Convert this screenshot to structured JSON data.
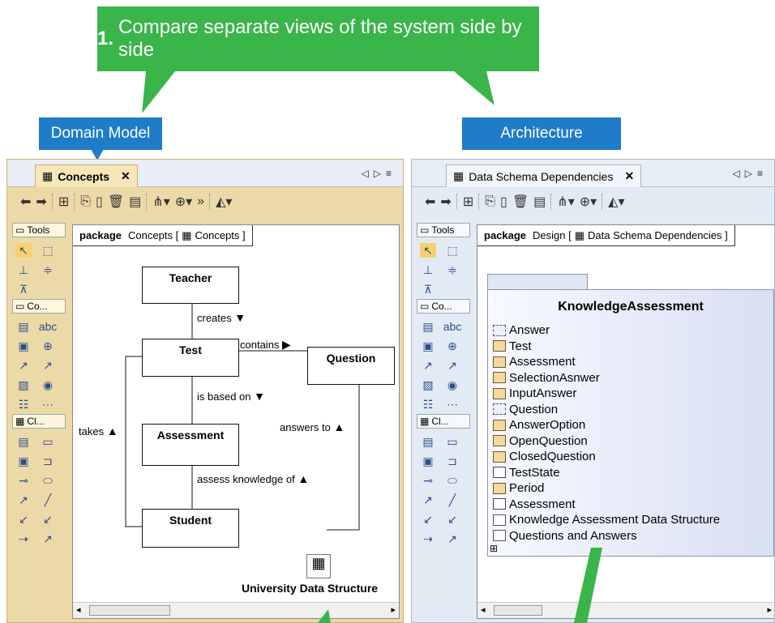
{
  "callouts": {
    "main_number": "1.",
    "main_text": "Compare separate views of the system side by side",
    "left": "Domain Model",
    "right": "Architecture"
  },
  "left": {
    "tab_label": "Concepts",
    "frame_keyword": "package",
    "frame_name": "Concepts [",
    "frame_diagram": "Concepts ]",
    "toolbox_tools": "Tools",
    "toolbox_co": "Co...",
    "toolbox_cl": "Cl...",
    "classes": {
      "teacher": "Teacher",
      "test": "Test",
      "question": "Question",
      "assessment": "Assessment",
      "student": "Student"
    },
    "labels": {
      "creates": "creates",
      "contains": "contains",
      "is_based_on": "is based on",
      "answers_to": "answers to",
      "takes": "takes",
      "assess_knowledge_of": "assess knowledge of"
    },
    "diagram_ref": "University Data Structure"
  },
  "right": {
    "tab_label": "Data Schema Dependencies",
    "frame_keyword": "package",
    "frame_name": "Design [",
    "frame_diagram": "Data Schema Dependencies ]",
    "toolbox_tools": "Tools",
    "toolbox_co": "Co...",
    "toolbox_cl": "Cl...",
    "package_title": "KnowledgeAssessment",
    "items": [
      {
        "label": "Answer",
        "icon": "dash"
      },
      {
        "label": "Test",
        "icon": "class"
      },
      {
        "label": "Assessment",
        "icon": "class"
      },
      {
        "label": "SelectionAsnwer",
        "icon": "class"
      },
      {
        "label": "InputAnswer",
        "icon": "class"
      },
      {
        "label": "Question",
        "icon": "dash"
      },
      {
        "label": "AnswerOption",
        "icon": "class"
      },
      {
        "label": "OpenQuestion",
        "icon": "class"
      },
      {
        "label": "ClosedQuestion",
        "icon": "class"
      },
      {
        "label": "TestState",
        "icon": "enum"
      },
      {
        "label": "Period",
        "icon": "class"
      },
      {
        "label": "Assessment",
        "icon": "enum"
      },
      {
        "label": "Knowledge Assessment Data Structure",
        "icon": "pkg"
      },
      {
        "label": "Questions and Answers",
        "icon": "pkg"
      }
    ]
  },
  "colors": {
    "green": "#39b54a",
    "blue": "#1f7cc9"
  }
}
